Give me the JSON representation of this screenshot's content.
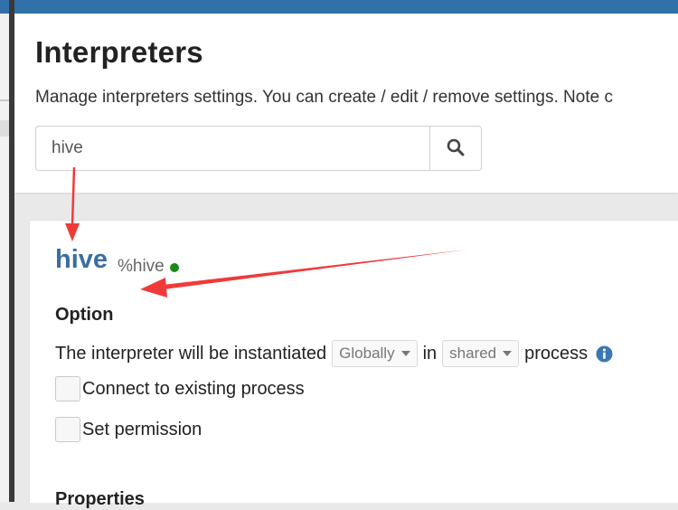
{
  "header": {
    "title": "Interpreters",
    "description": "Manage interpreters settings. You can create / edit / remove settings. Note c"
  },
  "search": {
    "value": "hive"
  },
  "interpreter": {
    "name": "hive",
    "alias": "%hive",
    "status_color": "#1b8a1b",
    "option_title": "Option",
    "instantiated_prefix": "The interpreter will be instantiated",
    "scope": "Globally",
    "in_text": "in",
    "mode": "shared",
    "process_text": "process",
    "connect_existing_label": "Connect to existing process",
    "set_permission_label": "Set permission",
    "properties_title": "Properties"
  },
  "colors": {
    "topbar": "#3071a9",
    "accent": "#3a6e9e",
    "annotation_arrow": "#f03a3a"
  }
}
